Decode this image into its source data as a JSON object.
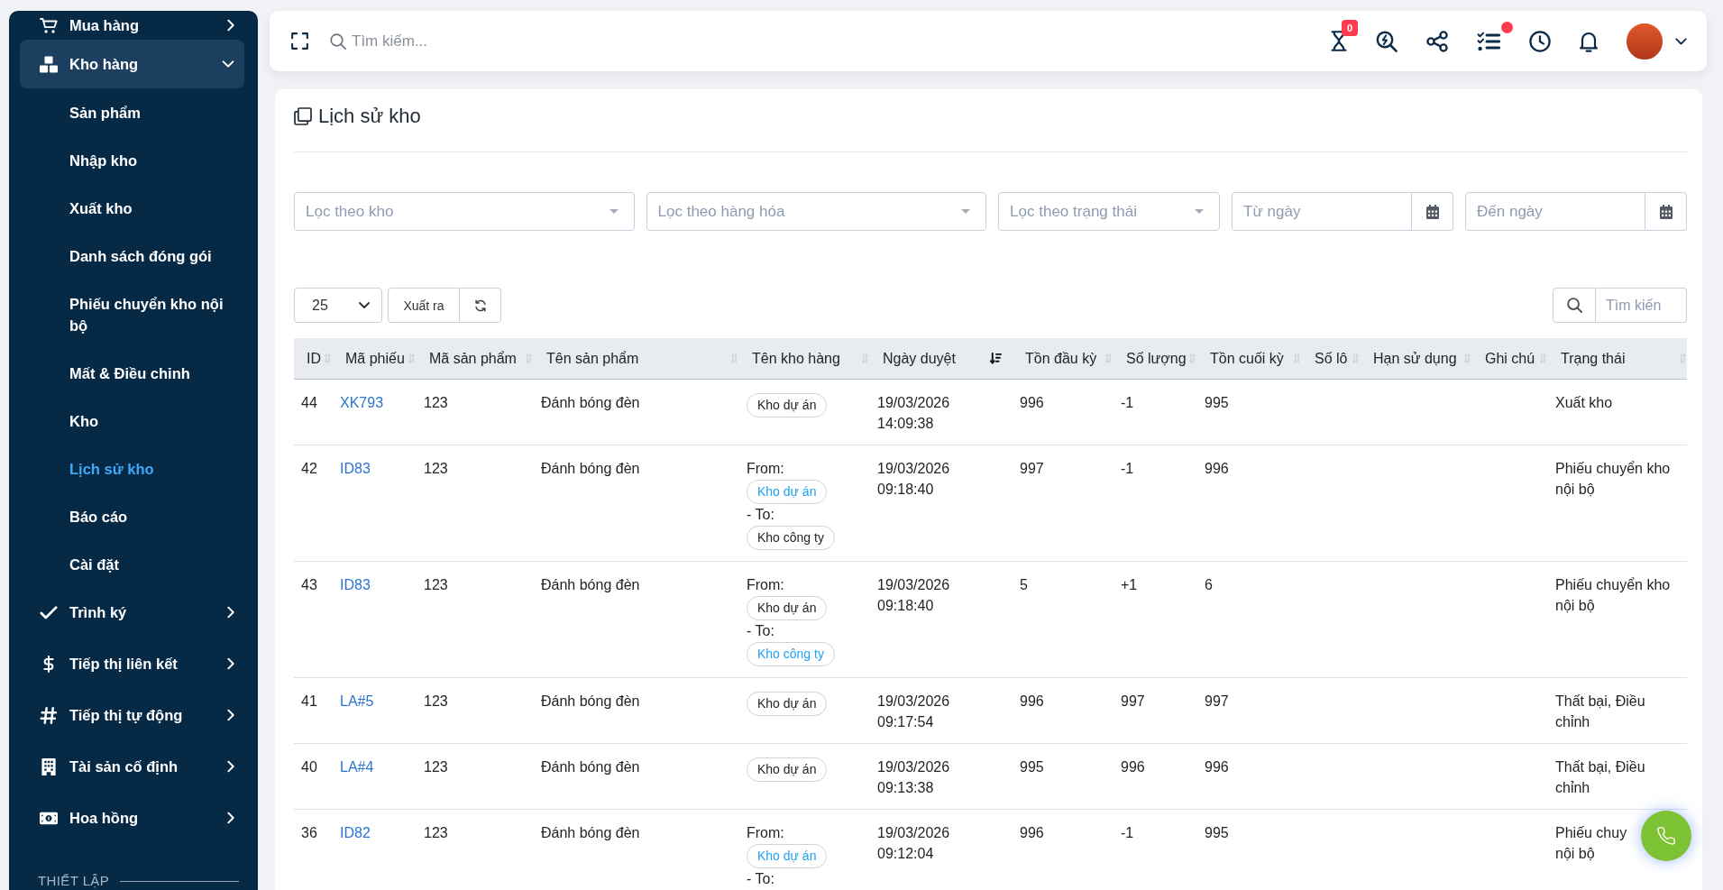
{
  "sidebar": {
    "items": [
      {
        "label": "Mua hàng",
        "expanded": false
      },
      {
        "label": "Kho hàng",
        "expanded": true,
        "children": [
          {
            "label": "Sản phẩm",
            "selected": false
          },
          {
            "label": "Nhập kho",
            "selected": false
          },
          {
            "label": "Xuất kho",
            "selected": false
          },
          {
            "label": "Danh sách đóng gói",
            "selected": false
          },
          {
            "label": "Phiếu chuyển kho nội bộ",
            "selected": false
          },
          {
            "label": "Mất & Điều chỉnh",
            "selected": false
          },
          {
            "label": "Kho",
            "selected": false
          },
          {
            "label": "Lịch sử kho",
            "selected": true
          },
          {
            "label": "Báo cáo",
            "selected": false
          },
          {
            "label": "Cài đặt",
            "selected": false
          }
        ]
      },
      {
        "label": "Trình ký",
        "expanded": false
      },
      {
        "label": "Tiếp thị liên kết",
        "expanded": false
      },
      {
        "label": "Tiếp thị tự động",
        "expanded": false
      },
      {
        "label": "Tài sản cố định",
        "expanded": false
      },
      {
        "label": "Hoa hồng",
        "expanded": false
      }
    ],
    "section_heading": "THIẾT LẬP"
  },
  "header": {
    "search_placeholder": "Tìm kiếm...",
    "timer_badge": "0",
    "tasks_alert": true
  },
  "page": {
    "title": "Lịch sử kho"
  },
  "filters": [
    {
      "kind": "select",
      "placeholder": "Lọc theo kho"
    },
    {
      "kind": "select",
      "placeholder": "Lọc theo hàng hóa"
    },
    {
      "kind": "select",
      "placeholder": "Lọc theo trạng thái"
    },
    {
      "kind": "date",
      "placeholder": "Từ ngày"
    },
    {
      "kind": "date",
      "placeholder": "Đến ngày"
    }
  ],
  "table_tools": {
    "page_length": "25",
    "export_button": "Xuất ra",
    "search_placeholder": "Tìm kiến"
  },
  "table": {
    "columns": [
      {
        "label": "ID",
        "sorted": false
      },
      {
        "label": "Mã phiếu",
        "sorted": false
      },
      {
        "label": "Mã sản phẩm",
        "sorted": false
      },
      {
        "label": "Tên sản phẩm",
        "sorted": false
      },
      {
        "label": "Tên kho hàng",
        "sorted": false
      },
      {
        "label": "Ngày duyệt",
        "sorted": true
      },
      {
        "label": "Tồn đầu kỳ",
        "sorted": false
      },
      {
        "label": "Số lượng",
        "sorted": false
      },
      {
        "label": "Tồn cuối kỳ",
        "sorted": false
      },
      {
        "label": "Số lô",
        "sorted": false
      },
      {
        "label": "Hạn sử dụng",
        "sorted": false
      },
      {
        "label": "Ghi chú",
        "sorted": false
      },
      {
        "label": "Trạng thái",
        "sorted": false
      }
    ],
    "rows": [
      {
        "id": "44",
        "code": "XK793",
        "product_code": "123",
        "product_name": "Đánh bóng đèn",
        "warehouse": {
          "kind": "single",
          "tag": {
            "name": "Kho dự án",
            "active": false
          }
        },
        "approved": "19/03/2026 14:09:38",
        "opening": "996",
        "quantity": "-1",
        "closing": "995",
        "status": "Xuất kho"
      },
      {
        "id": "42",
        "code": "ID83",
        "product_code": "123",
        "product_name": "Đánh bóng đèn",
        "warehouse": {
          "kind": "transfer",
          "from_label": "From:",
          "from": {
            "name": "Kho dự án",
            "active": true
          },
          "to_label": "- To:",
          "to": {
            "name": "Kho công ty",
            "active": false
          }
        },
        "approved": "19/03/2026 09:18:40",
        "opening": "997",
        "quantity": "-1",
        "closing": "996",
        "status": "Phiếu chuyển kho nội bộ"
      },
      {
        "id": "43",
        "code": "ID83",
        "product_code": "123",
        "product_name": "Đánh bóng đèn",
        "warehouse": {
          "kind": "transfer",
          "from_label": "From:",
          "from": {
            "name": "Kho dự án",
            "active": false
          },
          "to_label": "- To:",
          "to": {
            "name": "Kho công ty",
            "active": true
          }
        },
        "approved": "19/03/2026 09:18:40",
        "opening": "5",
        "quantity": "+1",
        "closing": "6",
        "status": "Phiếu chuyển kho nội bộ"
      },
      {
        "id": "41",
        "code": "LA#5",
        "product_code": "123",
        "product_name": "Đánh bóng đèn",
        "warehouse": {
          "kind": "single",
          "tag": {
            "name": "Kho dự án",
            "active": false
          }
        },
        "approved": "19/03/2026 09:17:54",
        "opening": "996",
        "quantity": "997",
        "closing": "997",
        "status": "Thất bại, Điều chỉnh"
      },
      {
        "id": "40",
        "code": "LA#4",
        "product_code": "123",
        "product_name": "Đánh bóng đèn",
        "warehouse": {
          "kind": "single",
          "tag": {
            "name": "Kho dự án",
            "active": false
          }
        },
        "approved": "19/03/2026 09:13:38",
        "opening": "995",
        "quantity": "996",
        "closing": "996",
        "status": "Thất bại, Điều chỉnh"
      },
      {
        "id": "36",
        "code": "ID82",
        "product_code": "123",
        "product_name": "Đánh bóng đèn",
        "warehouse": {
          "kind": "transfer",
          "from_label": "From:",
          "from": {
            "name": "Kho dự án",
            "active": true
          },
          "to_label": "- To:"
        },
        "approved": "19/03/2026 09:12:04",
        "opening": "996",
        "quantity": "-1",
        "closing": "995",
        "status": "Phiếu chuy\nnội bộ"
      }
    ]
  }
}
